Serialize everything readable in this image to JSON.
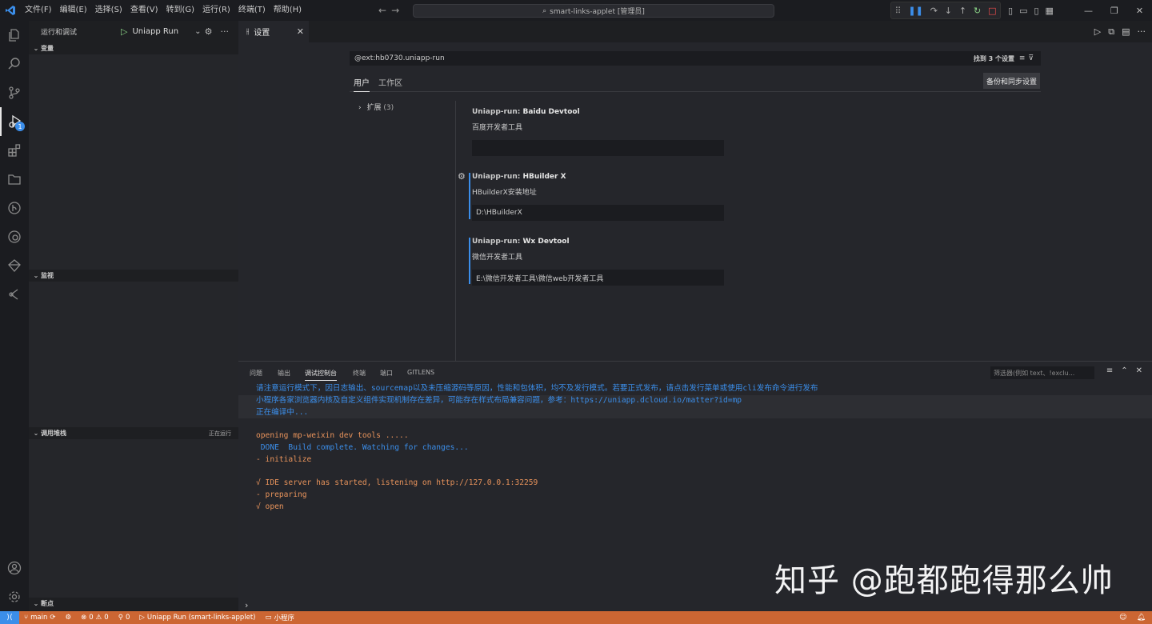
{
  "titlebar": {
    "menu": [
      "文件(F)",
      "编辑(E)",
      "选择(S)",
      "查看(V)",
      "转到(G)",
      "运行(R)",
      "终端(T)",
      "帮助(H)"
    ],
    "command_center": "smart-links-applet [管理员]"
  },
  "activity": {
    "debug_badge": "1"
  },
  "sidebar": {
    "title": "运行和调试",
    "run_config": "Uniapp Run",
    "sections": {
      "variables": "变量",
      "watch": "监视",
      "callstack": "调用堆栈",
      "callstack_status": "正在运行",
      "breakpoints": "断点"
    }
  },
  "editor": {
    "tab_label": "设置",
    "search_value": "@ext:hb0730.uniapp-run",
    "search_result": "找到 3 个设置",
    "scope_user": "用户",
    "scope_workspace": "工作区",
    "backup_button": "备份和同步设置",
    "toc_item": "扩展",
    "toc_count": "(3)",
    "settings": [
      {
        "category": "Uniapp-run: ",
        "name": "Baidu Devtool",
        "description": "百度开发者工具",
        "value": ""
      },
      {
        "category": "Uniapp-run: ",
        "name": "HBuilder X",
        "description": "HBuilderX安装地址",
        "value": "D:\\HBuilderX"
      },
      {
        "category": "Uniapp-run: ",
        "name": "Wx Devtool",
        "description": "微信开发者工具",
        "value": "E:\\微信开发者工具\\微信web开发者工具"
      }
    ]
  },
  "panel": {
    "tabs": [
      "问题",
      "输出",
      "调试控制台",
      "终端",
      "端口",
      "GITLENS"
    ],
    "filter_placeholder": "筛选器(例如 text、!exclu...",
    "console_lines": [
      {
        "text": "请注意运行模式下，因日志输出、sourcemap以及未压缩源码等原因，性能和包体积，均不及发行模式。若要正式发布，请点击发行菜单或使用cli发布命令进行发布",
        "color": "blue",
        "highlight": false
      },
      {
        "text": "小程序各家浏览器内核及自定义组件实现机制存在差异，可能存在样式布局兼容问题，参考：https://uniapp.dcloud.io/matter?id=mp",
        "color": "blue",
        "highlight": true
      },
      {
        "text": "正在编译中...",
        "color": "blue",
        "highlight": true
      },
      {
        "text": "",
        "color": "blue",
        "highlight": false
      },
      {
        "text": "opening mp-weixin dev tools .....",
        "color": "orange",
        "highlight": false
      },
      {
        "text": " DONE  Build complete. Watching for changes...",
        "color": "cyan",
        "highlight": false
      },
      {
        "text": "- initialize",
        "color": "orange",
        "highlight": false
      },
      {
        "text": "",
        "color": "orange",
        "highlight": false
      },
      {
        "text": "√ IDE server has started, listening on http://127.0.0.1:32259",
        "color": "orange",
        "highlight": false
      },
      {
        "text": "- preparing",
        "color": "orange",
        "highlight": false
      },
      {
        "text": "√ open",
        "color": "orange",
        "highlight": false
      }
    ]
  },
  "statusbar": {
    "branch": "main",
    "errors": "0",
    "warnings": "0",
    "ports": "0",
    "run_label": "Uniapp Run (smart-links-applet)",
    "mini_program": "小程序"
  },
  "watermark": "知乎 @跑都跑得那么帅",
  "colors": {
    "accent": "#3b8eea",
    "statusbar": "#cc6633",
    "console_orange": "#e8935b"
  }
}
